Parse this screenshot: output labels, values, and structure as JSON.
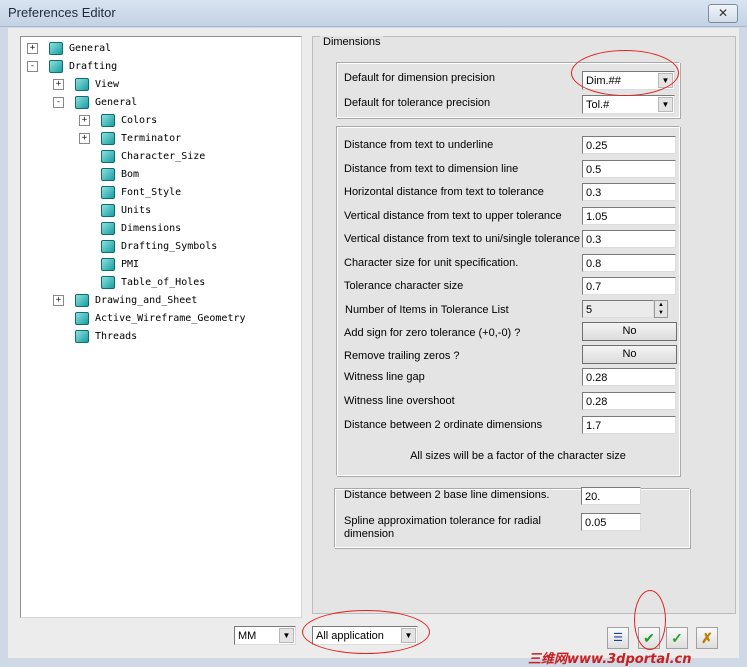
{
  "window": {
    "title": "Preferences Editor",
    "close_icon": "close-icon"
  },
  "tree": {
    "items": [
      {
        "label": "General",
        "level": 0,
        "expander": "+"
      },
      {
        "label": "Drafting",
        "level": 0,
        "expander": "-"
      },
      {
        "label": "View",
        "level": 1,
        "expander": "+"
      },
      {
        "label": "General",
        "level": 1,
        "expander": "-"
      },
      {
        "label": "Colors",
        "level": 2,
        "expander": "+"
      },
      {
        "label": "Terminator",
        "level": 2,
        "expander": "+"
      },
      {
        "label": "Character_Size",
        "level": 2,
        "expander": ""
      },
      {
        "label": "Bom",
        "level": 2,
        "expander": ""
      },
      {
        "label": "Font_Style",
        "level": 2,
        "expander": ""
      },
      {
        "label": "Units",
        "level": 2,
        "expander": ""
      },
      {
        "label": "Dimensions",
        "level": 2,
        "expander": ""
      },
      {
        "label": "Drafting_Symbols",
        "level": 2,
        "expander": ""
      },
      {
        "label": "PMI",
        "level": 2,
        "expander": ""
      },
      {
        "label": "Table_of_Holes",
        "level": 2,
        "expander": ""
      },
      {
        "label": "Drawing_and_Sheet",
        "level": 1,
        "expander": "+"
      },
      {
        "label": "Active_Wireframe_Geometry",
        "level": 1,
        "expander": ""
      },
      {
        "label": "Threads",
        "level": 1,
        "expander": ""
      }
    ]
  },
  "dimensions": {
    "group_title": "Dimensions",
    "precision": {
      "dim_label": "Default for dimension precision",
      "dim_value": "Dim.##",
      "tol_label": "Default for tolerance precision",
      "tol_value": "Tol.#"
    },
    "rows": [
      {
        "label": "Distance from text to underline",
        "value": "0.25"
      },
      {
        "label": "Distance from text to dimension line",
        "value": "0.5"
      },
      {
        "label": "Horizontal distance from text to tolerance",
        "value": "0.3"
      },
      {
        "label": "Vertical distance from text to upper tolerance",
        "value": "1.05"
      },
      {
        "label": "Vertical distance from text to uni/single tolerance",
        "value": "0.3"
      },
      {
        "label": "Character size for unit specification.",
        "value": "0.8"
      },
      {
        "label": "Tolerance character size",
        "value": "0.7"
      }
    ],
    "tolerance_list": {
      "label": "Number of Items in Tolerance List",
      "value": "5"
    },
    "zero_sign": {
      "label": "Add sign for zero tolerance (+0,-0) ?",
      "value": "No"
    },
    "trailing_zeros": {
      "label": "Remove trailing zeros ?",
      "value": "No"
    },
    "rows2": [
      {
        "label": "Witness line gap",
        "value": "0.28"
      },
      {
        "label": "Witness line overshoot",
        "value": "0.28"
      },
      {
        "label": "Distance between 2 ordinate dimensions",
        "value": "1.7"
      }
    ],
    "note": "All sizes will be a factor of the character size",
    "baseline": {
      "label": "Distance between 2 base line dimensions.",
      "value": "20.",
      "spline_label_1": "Spline approximation tolerance for radial",
      "spline_label_2": "dimension",
      "spline_value": "0.05"
    }
  },
  "bottom": {
    "units_value": "MM",
    "scope_value": "All application",
    "icons": [
      "list-icon",
      "apply-icon",
      "ok-icon",
      "cancel-icon"
    ]
  },
  "watermark": "三维网www.3dportal.cn",
  "colors": {
    "annotation": "#e0231f",
    "tree_icon": "#1a9ea0"
  }
}
